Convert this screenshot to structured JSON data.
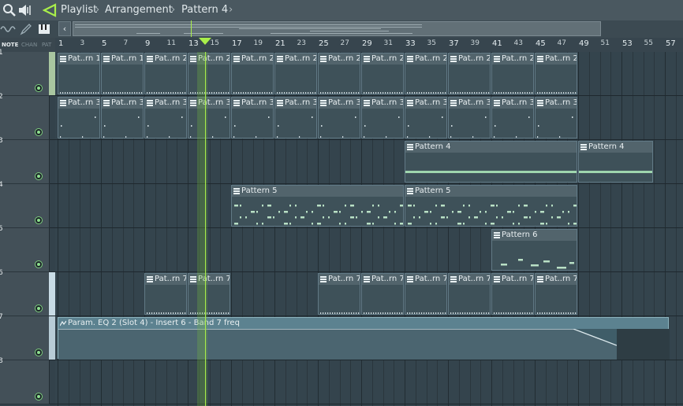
{
  "title": {
    "app": "Playlist",
    "section": "Arrangement",
    "pattern": "Pattern 4"
  },
  "toolbar": {
    "mode_labels": [
      "NOTE",
      "CHAN",
      "PAT"
    ],
    "icons": [
      "magnifier-icon",
      "speaker-icon",
      "arrow-icon",
      "wave-icon",
      "pencil-icon",
      "piano-icon"
    ],
    "accent_color": "#a9ee4a"
  },
  "ruler": {
    "bars": [
      "1",
      "3",
      "5",
      "7",
      "9",
      "11",
      "13",
      "15",
      "17",
      "19",
      "21",
      "23",
      "25",
      "27",
      "29",
      "31",
      "33",
      "35",
      "37",
      "39",
      "41",
      "43",
      "45",
      "47",
      "49",
      "51",
      "53",
      "55",
      "57"
    ],
    "playhead_bar": 15
  },
  "tracks": [
    {
      "num": "1",
      "clips": [
        {
          "label": "Pat..rn 1",
          "start": 1,
          "len": 2,
          "kind": "ticks"
        },
        {
          "label": "Pat..rn 1",
          "start": 5,
          "len": 2,
          "kind": "ticks"
        },
        {
          "label": "Pat..rn 2",
          "start": 9,
          "len": 2,
          "kind": "ticks"
        },
        {
          "label": "Pat..rn 2",
          "start": 13,
          "len": 2,
          "kind": "ticks"
        },
        {
          "label": "Pat..rn 2",
          "start": 17,
          "len": 2,
          "kind": "ticks"
        },
        {
          "label": "Pat..rn 2",
          "start": 21,
          "len": 2,
          "kind": "ticks"
        },
        {
          "label": "Pat..rn 2",
          "start": 25,
          "len": 2,
          "kind": "ticks"
        },
        {
          "label": "Pat..rn 2",
          "start": 29,
          "len": 2,
          "kind": "ticks"
        },
        {
          "label": "Pat..rn 2",
          "start": 33,
          "len": 2,
          "kind": "ticks"
        },
        {
          "label": "Pat..rn 2",
          "start": 37,
          "len": 2,
          "kind": "ticks"
        },
        {
          "label": "Pat..rn 2",
          "start": 41,
          "len": 2,
          "kind": "ticks"
        },
        {
          "label": "Pat..rn 2",
          "start": 45,
          "len": 2,
          "kind": "ticks"
        }
      ]
    },
    {
      "num": "2",
      "clips": [
        {
          "label": "Pat..rn 3",
          "start": 1,
          "len": 2,
          "kind": "sparse"
        },
        {
          "label": "Pat..rn 3",
          "start": 5,
          "len": 2,
          "kind": "sparse"
        },
        {
          "label": "Pat..rn 3",
          "start": 9,
          "len": 2,
          "kind": "sparse"
        },
        {
          "label": "Pat..rn 3",
          "start": 13,
          "len": 2,
          "kind": "sparse"
        },
        {
          "label": "Pat..rn 3",
          "start": 17,
          "len": 2,
          "kind": "sparse"
        },
        {
          "label": "Pat..rn 3",
          "start": 21,
          "len": 2,
          "kind": "sparse"
        },
        {
          "label": "Pat..rn 3",
          "start": 25,
          "len": 2,
          "kind": "sparse"
        },
        {
          "label": "Pat..rn 3",
          "start": 29,
          "len": 2,
          "kind": "sparse"
        },
        {
          "label": "Pat..rn 3",
          "start": 33,
          "len": 2,
          "kind": "sparse"
        },
        {
          "label": "Pat..rn 3",
          "start": 37,
          "len": 2,
          "kind": "sparse"
        },
        {
          "label": "Pat..rn 3",
          "start": 41,
          "len": 2,
          "kind": "sparse"
        },
        {
          "label": "Pat..rn 3",
          "start": 45,
          "len": 2,
          "kind": "sparse"
        }
      ]
    },
    {
      "num": "3",
      "clips": [
        {
          "label": "Pattern 4",
          "start": 33,
          "len": 8,
          "kind": "line"
        },
        {
          "label": "Pattern 4",
          "start": 49,
          "len": 3.5,
          "kind": "line"
        }
      ]
    },
    {
      "num": "4",
      "clips": [
        {
          "label": "Pattern 5",
          "start": 17,
          "len": 8,
          "kind": "dense"
        },
        {
          "label": "Pattern 5",
          "start": 33,
          "len": 8,
          "kind": "dense"
        }
      ]
    },
    {
      "num": "5",
      "clips": [
        {
          "label": "Pattern 6",
          "start": 41,
          "len": 4,
          "kind": "melody"
        }
      ]
    },
    {
      "num": "6",
      "clips": [
        {
          "label": "Pat..rn 7",
          "start": 9,
          "len": 2,
          "kind": "ticks"
        },
        {
          "label": "Pat..rn 7",
          "start": 13,
          "len": 2,
          "kind": "ticks"
        },
        {
          "label": "Pat..rn 7",
          "start": 25,
          "len": 2,
          "kind": "ticks"
        },
        {
          "label": "Pat..rn 7",
          "start": 29,
          "len": 2,
          "kind": "ticks"
        },
        {
          "label": "Pat..rn 7",
          "start": 33,
          "len": 2,
          "kind": "ticks"
        },
        {
          "label": "Pat..rn 7",
          "start": 37,
          "len": 2,
          "kind": "ticks"
        },
        {
          "label": "Pat..rn 7",
          "start": 41,
          "len": 2,
          "kind": "ticks"
        },
        {
          "label": "Pat..rn 7",
          "start": 45,
          "len": 2,
          "kind": "ticks"
        }
      ]
    },
    {
      "num": "7",
      "clips": [
        {
          "label": "Param. EQ 2 (Slot 4) - Insert 6 - Band 7 freq",
          "start": 1,
          "len": 28.2,
          "kind": "automation"
        }
      ]
    },
    {
      "num": "8",
      "clips": []
    }
  ]
}
